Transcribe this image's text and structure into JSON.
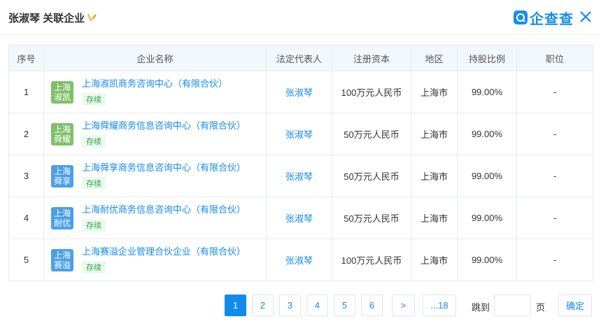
{
  "header": {
    "title": "张淑琴 关联企业",
    "brand_name": "企查查"
  },
  "table": {
    "columns": [
      "序号",
      "企业名称",
      "法定代表人",
      "注册资本",
      "地区",
      "持股比例",
      "职位"
    ],
    "rows": [
      {
        "index": "1",
        "logo_line1": "上海",
        "logo_line2": "淑凯",
        "logo_color": "#7fc06a",
        "name": "上海淑凯商务咨询中心（有限合伙）",
        "status": "存续",
        "legal_rep": "张淑琴",
        "capital": "100万元人民币",
        "region": "上海市",
        "ratio": "99.00%",
        "position": "-"
      },
      {
        "index": "2",
        "logo_line1": "上海",
        "logo_line2": "舜耀",
        "logo_color": "#7fc06a",
        "name": "上海舜耀商务信息咨询中心（有限合伙）",
        "status": "存续",
        "legal_rep": "张淑琴",
        "capital": "50万元人民币",
        "region": "上海市",
        "ratio": "99.00%",
        "position": "-"
      },
      {
        "index": "3",
        "logo_line1": "上海",
        "logo_line2": "舜享",
        "logo_color": "#4b9fe8",
        "name": "上海舜享商务信息咨询中心（有限合伙）",
        "status": "存续",
        "legal_rep": "张淑琴",
        "capital": "50万元人民币",
        "region": "上海市",
        "ratio": "99.00%",
        "position": "-"
      },
      {
        "index": "4",
        "logo_line1": "上海",
        "logo_line2": "耐优",
        "logo_color": "#4b9fe8",
        "name": "上海耐优商务信息咨询中心（有限合伙）",
        "status": "存续",
        "legal_rep": "张淑琴",
        "capital": "50万元人民币",
        "region": "上海市",
        "ratio": "99.00%",
        "position": "-"
      },
      {
        "index": "5",
        "logo_line1": "上海",
        "logo_line2": "赛溢",
        "logo_color": "#4b9fe8",
        "name": "上海赛溢企业管理合伙企业（有限合伙）",
        "status": "存续",
        "legal_rep": "张淑琴",
        "capital": "100万元人民币",
        "region": "上海市",
        "ratio": "99.00%",
        "position": "-"
      }
    ]
  },
  "pagination": {
    "pages": [
      "1",
      "2",
      "3",
      "4",
      "5",
      "6"
    ],
    "current": "1",
    "next": ">",
    "last": "...18",
    "jump_label": "跳到",
    "page_unit": "页",
    "confirm": "确定"
  },
  "colors": {
    "accent": "#128bed",
    "header_bg": "#f2f7fc",
    "status_green": "#28a745",
    "edit_icon": "#f5a623"
  },
  "icons": [
    "edit-icon",
    "brand-logo-icon",
    "close-icon"
  ]
}
